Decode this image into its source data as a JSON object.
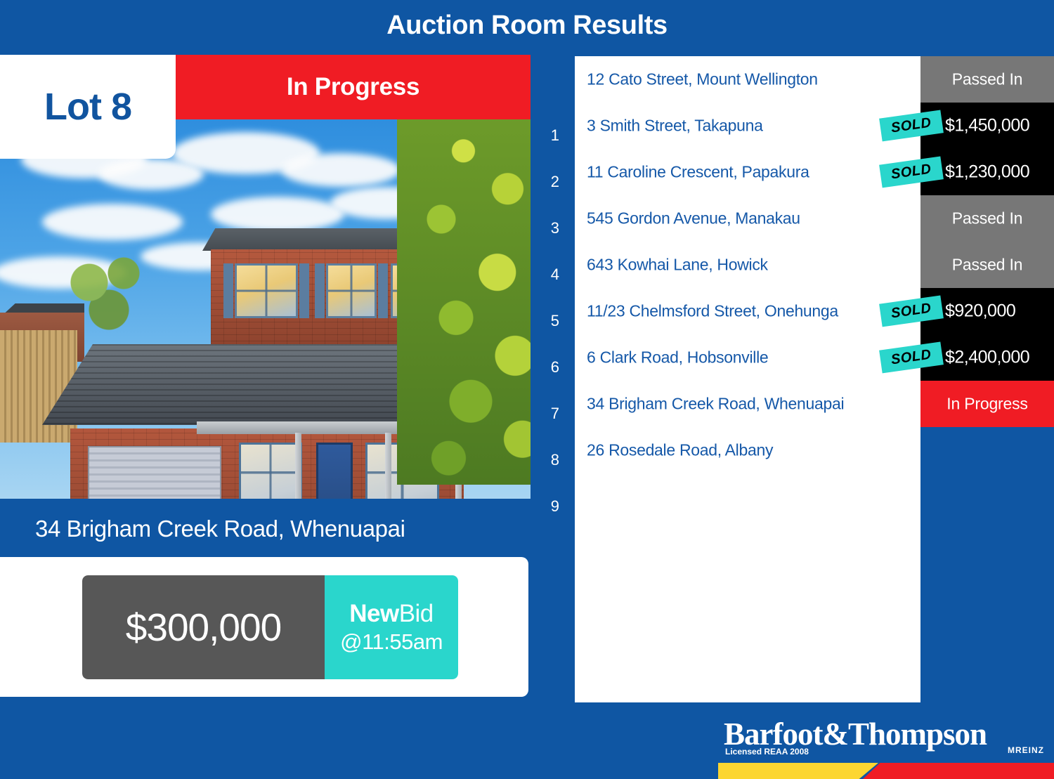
{
  "header": {
    "title": "Auction Room Results"
  },
  "featured": {
    "lot_label": "Lot 8",
    "status_label": "In Progress",
    "address": "34 Brigham Creek Road, Whenuapai",
    "bid": {
      "amount": "$300,000",
      "new_word": "New",
      "bid_word": "Bid",
      "time": "@11:55am"
    }
  },
  "results": {
    "sold_badge_label": "SOLD",
    "rows": [
      {
        "index": "1",
        "address": "12 Cato Street, Mount Wellington",
        "status": "Passed In",
        "price": "",
        "state": "passed-in"
      },
      {
        "index": "2",
        "address": "3 Smith Street, Takapuna",
        "status": "SOLD",
        "price": "$1,450,000",
        "state": "sold"
      },
      {
        "index": "3",
        "address": "11 Caroline Crescent, Papakura",
        "status": "SOLD",
        "price": "$1,230,000",
        "state": "sold"
      },
      {
        "index": "4",
        "address": "545 Gordon Avenue, Manakau",
        "status": "Passed In",
        "price": "",
        "state": "passed-in"
      },
      {
        "index": "5",
        "address": "643 Kowhai Lane, Howick",
        "status": "Passed In",
        "price": "",
        "state": "passed-in"
      },
      {
        "index": "6",
        "address": "11/23 Chelmsford Street, Onehunga",
        "status": "SOLD",
        "price": "$920,000",
        "state": "sold"
      },
      {
        "index": "7",
        "address": "6 Clark Road, Hobsonville",
        "status": "SOLD",
        "price": "$2,400,000",
        "state": "sold"
      },
      {
        "index": "8",
        "address": "34 Brigham Creek Road, Whenuapai",
        "status": "In Progress",
        "price": "",
        "state": "in-progress"
      },
      {
        "index": "9",
        "address": "26 Rosedale Road, Albany",
        "status": "",
        "price": "",
        "state": "pending"
      }
    ]
  },
  "branding": {
    "logo_text": "Barfoot&Thompson",
    "licensed": "Licensed REAA 2008",
    "mreinz": "MREINZ"
  },
  "colors": {
    "blue": "#0f56a3",
    "red": "#f01c24",
    "teal": "#2ad6cc",
    "gray": "#777777",
    "black": "#000000",
    "yellow": "#fcd631",
    "dark_gray": "#575757"
  }
}
